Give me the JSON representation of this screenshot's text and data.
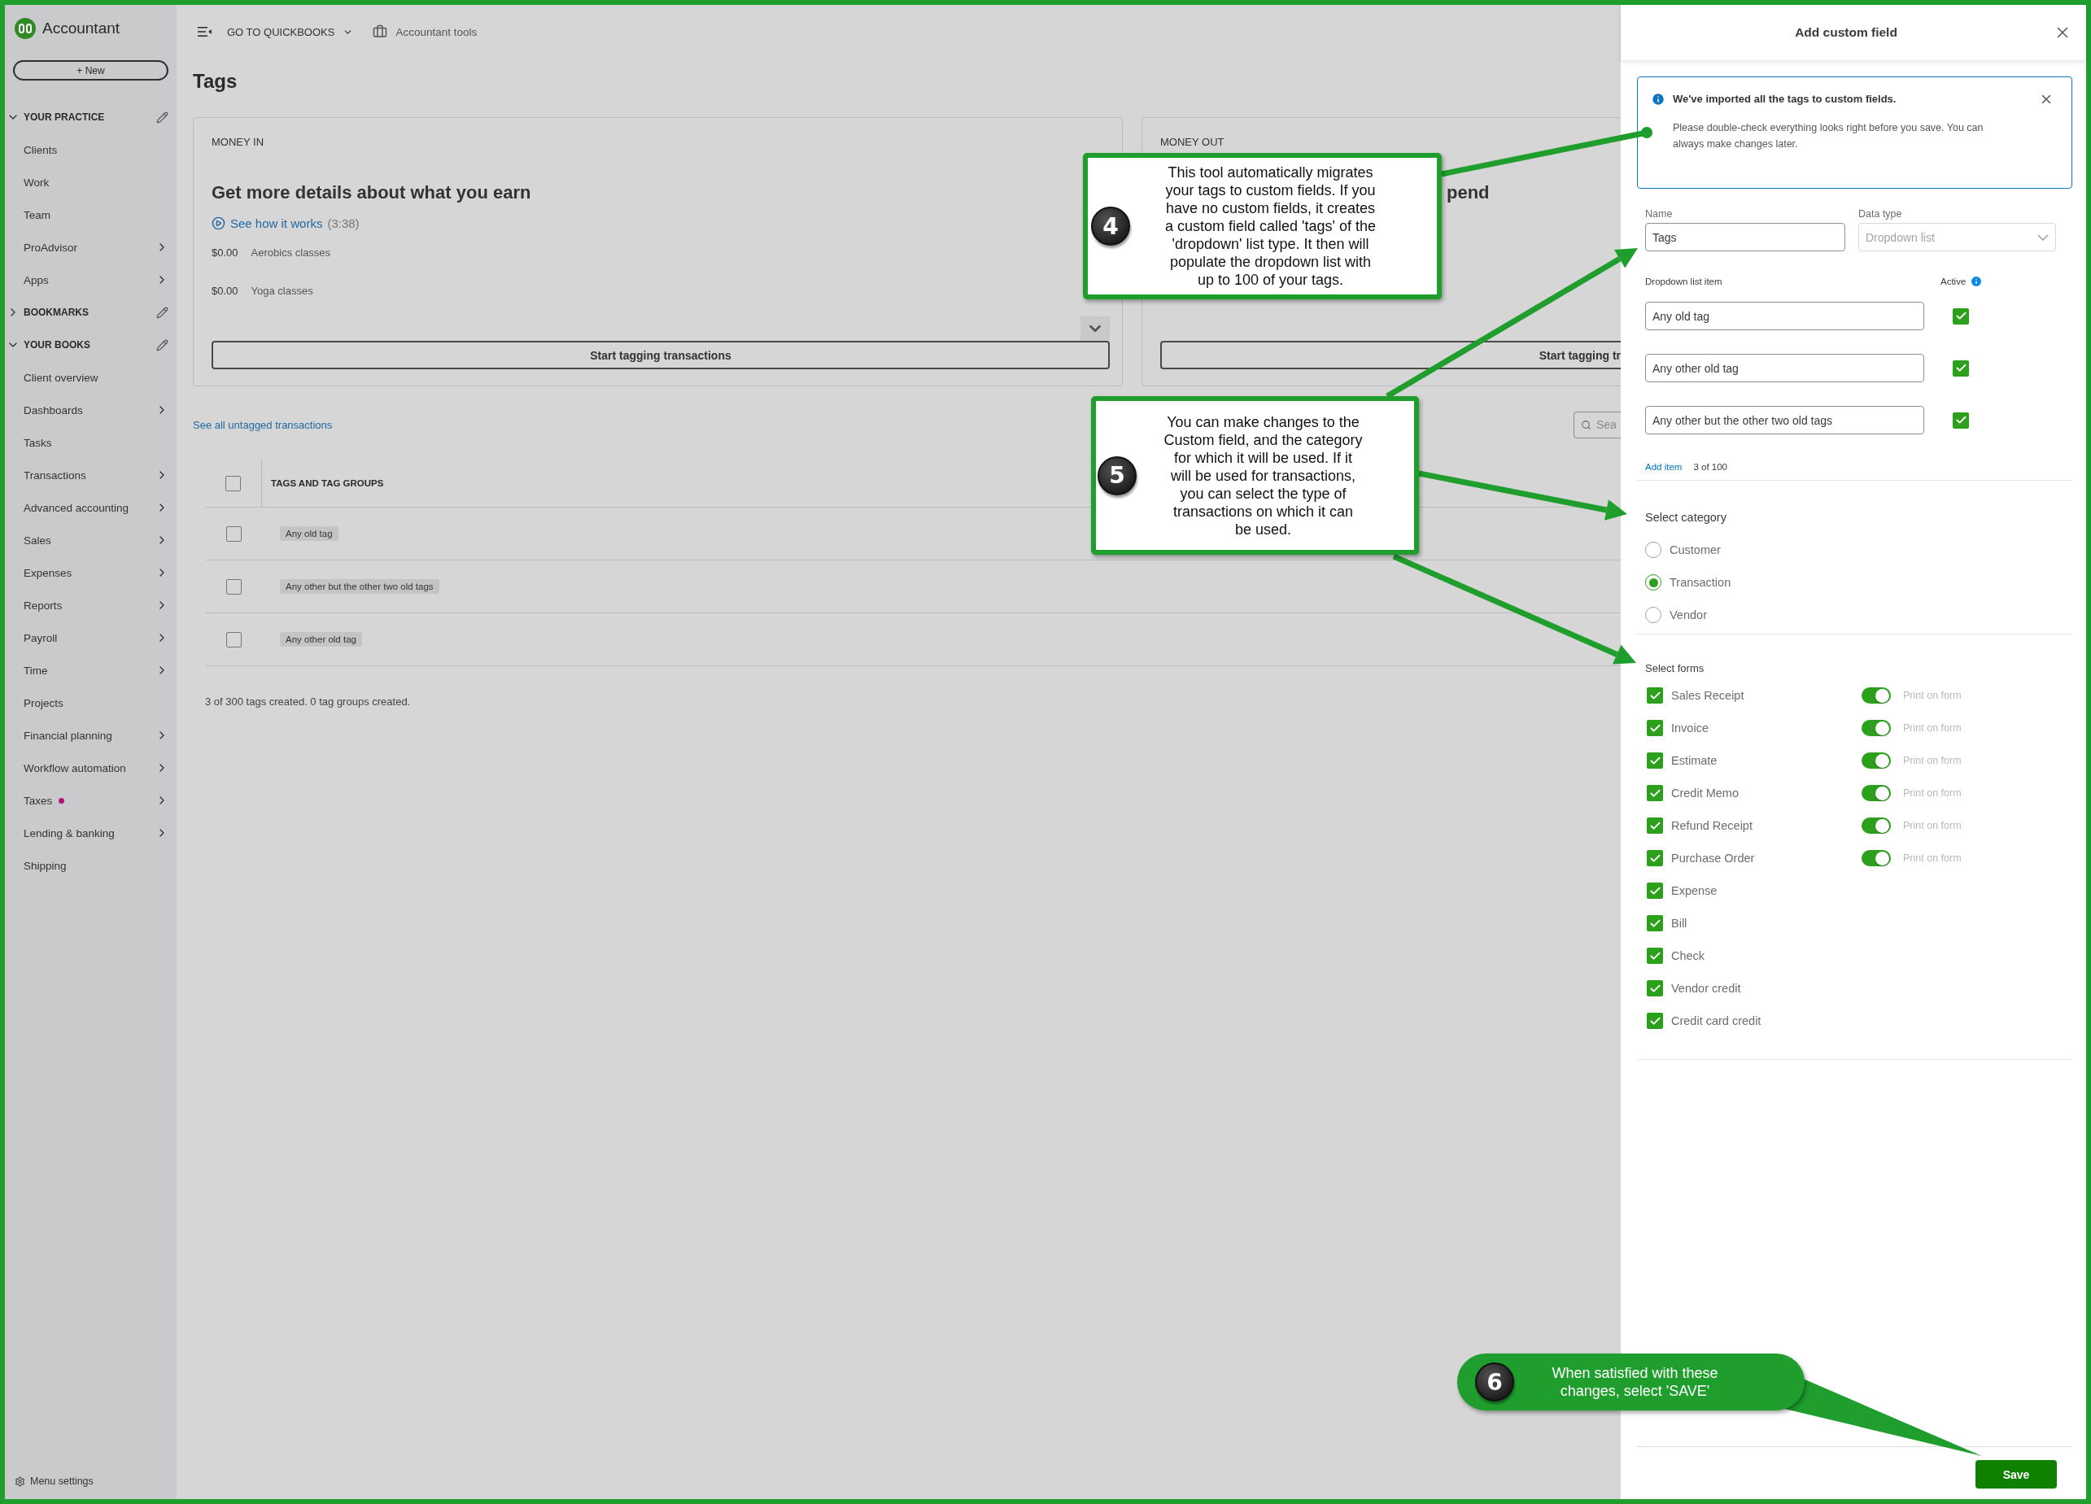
{
  "sidebar": {
    "app_name": "Accountant",
    "new_button": "+ New",
    "sections": [
      {
        "title": "YOUR PRACTICE",
        "expanded": true,
        "items": [
          {
            "label": "Clients",
            "submenu": false,
            "dot": false
          },
          {
            "label": "Work",
            "submenu": false,
            "dot": false
          },
          {
            "label": "Team",
            "submenu": false,
            "dot": false
          },
          {
            "label": "ProAdvisor",
            "submenu": true,
            "dot": false
          },
          {
            "label": "Apps",
            "submenu": true,
            "dot": false
          }
        ]
      },
      {
        "title": "BOOKMARKS",
        "expanded": false
      },
      {
        "title": "YOUR BOOKS",
        "expanded": true,
        "items": [
          {
            "label": "Client overview",
            "submenu": false,
            "dot": false
          },
          {
            "label": "Dashboards",
            "submenu": true,
            "dot": false
          },
          {
            "label": "Tasks",
            "submenu": false,
            "dot": false
          },
          {
            "label": "Transactions",
            "submenu": true,
            "dot": false
          },
          {
            "label": "Advanced accounting",
            "submenu": true,
            "dot": false
          },
          {
            "label": "Sales",
            "submenu": true,
            "dot": false
          },
          {
            "label": "Expenses",
            "submenu": true,
            "dot": false
          },
          {
            "label": "Reports",
            "submenu": true,
            "dot": false
          },
          {
            "label": "Payroll",
            "submenu": true,
            "dot": false
          },
          {
            "label": "Time",
            "submenu": true,
            "dot": false
          },
          {
            "label": "Projects",
            "submenu": false,
            "dot": false
          },
          {
            "label": "Financial planning",
            "submenu": true,
            "dot": false
          },
          {
            "label": "Workflow automation",
            "submenu": true,
            "dot": false
          },
          {
            "label": "Taxes",
            "submenu": true,
            "dot": true
          },
          {
            "label": "Lending & banking",
            "submenu": true,
            "dot": false
          },
          {
            "label": "Shipping",
            "submenu": false,
            "dot": false
          }
        ]
      }
    ],
    "footer": "Menu settings"
  },
  "topbar": {
    "menu": "GO TO QUICKBOOKS",
    "tools": "Accountant tools"
  },
  "page": {
    "title": "Tags",
    "cards": [
      {
        "label": "MONEY IN",
        "heading": "Get more details about what you earn",
        "video_link": "See how it works",
        "video_length": "(3:38)",
        "rows": [
          {
            "amount": "$0.00",
            "name": "Aerobics classes"
          },
          {
            "amount": "$0.00",
            "name": "Yoga classes"
          }
        ],
        "button": "Start tagging transactions"
      },
      {
        "label": "MONEY OUT",
        "heading": "pend",
        "button": "Start tagging tr"
      }
    ],
    "untagged_link": "See all untagged transactions",
    "search_placeholder": "Sea",
    "table": {
      "column": "TAGS AND TAG GROUPS",
      "checked": false,
      "rows": [
        {
          "tag": "Any old tag",
          "checked": false
        },
        {
          "tag": "Any other but the other two old tags",
          "checked": false
        },
        {
          "tag": "Any other old tag",
          "checked": false
        }
      ]
    },
    "summary": "3 of 300 tags created. 0 tag groups created."
  },
  "panel": {
    "title": "Add custom field",
    "notice": {
      "title": "We've imported all the tags to custom fields.",
      "body": "Please double-check everything looks right before you save. You can always make changes later."
    },
    "name_field": {
      "label": "Name",
      "value": "Tags",
      "disabled": false
    },
    "type_field": {
      "label": "Data type",
      "value": "Dropdown list",
      "disabled": true
    },
    "items_label": "Dropdown list item",
    "active_label": "Active",
    "items": [
      {
        "value": "Any old tag",
        "active": true
      },
      {
        "value": "Any other old tag",
        "active": true
      },
      {
        "value": "Any other but the other two old tags",
        "active": true
      }
    ],
    "add_item": "Add item",
    "item_count": "3 of 100",
    "category_label": "Select category",
    "categories": [
      {
        "label": "Customer",
        "selected": false
      },
      {
        "label": "Transaction",
        "selected": true
      },
      {
        "label": "Vendor",
        "selected": false
      }
    ],
    "forms_label": "Select forms",
    "forms": [
      {
        "label": "Sales Receipt",
        "checked": true,
        "print": {
          "on": true,
          "label": "Print on form"
        }
      },
      {
        "label": "Invoice",
        "checked": true,
        "print": {
          "on": true,
          "label": "Print on form"
        }
      },
      {
        "label": "Estimate",
        "checked": true,
        "print": {
          "on": true,
          "label": "Print on form"
        }
      },
      {
        "label": "Credit Memo",
        "checked": true,
        "print": {
          "on": true,
          "label": "Print on form"
        }
      },
      {
        "label": "Refund Receipt",
        "checked": true,
        "print": {
          "on": true,
          "label": "Print on form"
        }
      },
      {
        "label": "Purchase Order",
        "checked": true,
        "print": {
          "on": true,
          "label": "Print on form"
        }
      },
      {
        "label": "Expense",
        "checked": true
      },
      {
        "label": "Bill",
        "checked": true
      },
      {
        "label": "Check",
        "checked": true
      },
      {
        "label": "Vendor credit",
        "checked": true
      },
      {
        "label": "Credit card credit",
        "checked": true
      }
    ],
    "save_button": "Save"
  },
  "callouts": [
    {
      "number": "4",
      "text": "This tool automatically migrates\nyour tags to custom fields. If you\nhave no custom fields, it creates\na custom field called 'tags' of the\n'dropdown' list type. It then will\npopulate the dropdown list with\nup to 100 of your tags."
    },
    {
      "number": "5",
      "text": "You can make changes to the\nCustom field, and the category\nfor which it will be used. If it\nwill be used for transactions,\nyou can select the type of\ntransactions on which it can\nbe used."
    },
    {
      "number": "6",
      "text": "When satisfied with these\nchanges, select 'SAVE'"
    }
  ]
}
